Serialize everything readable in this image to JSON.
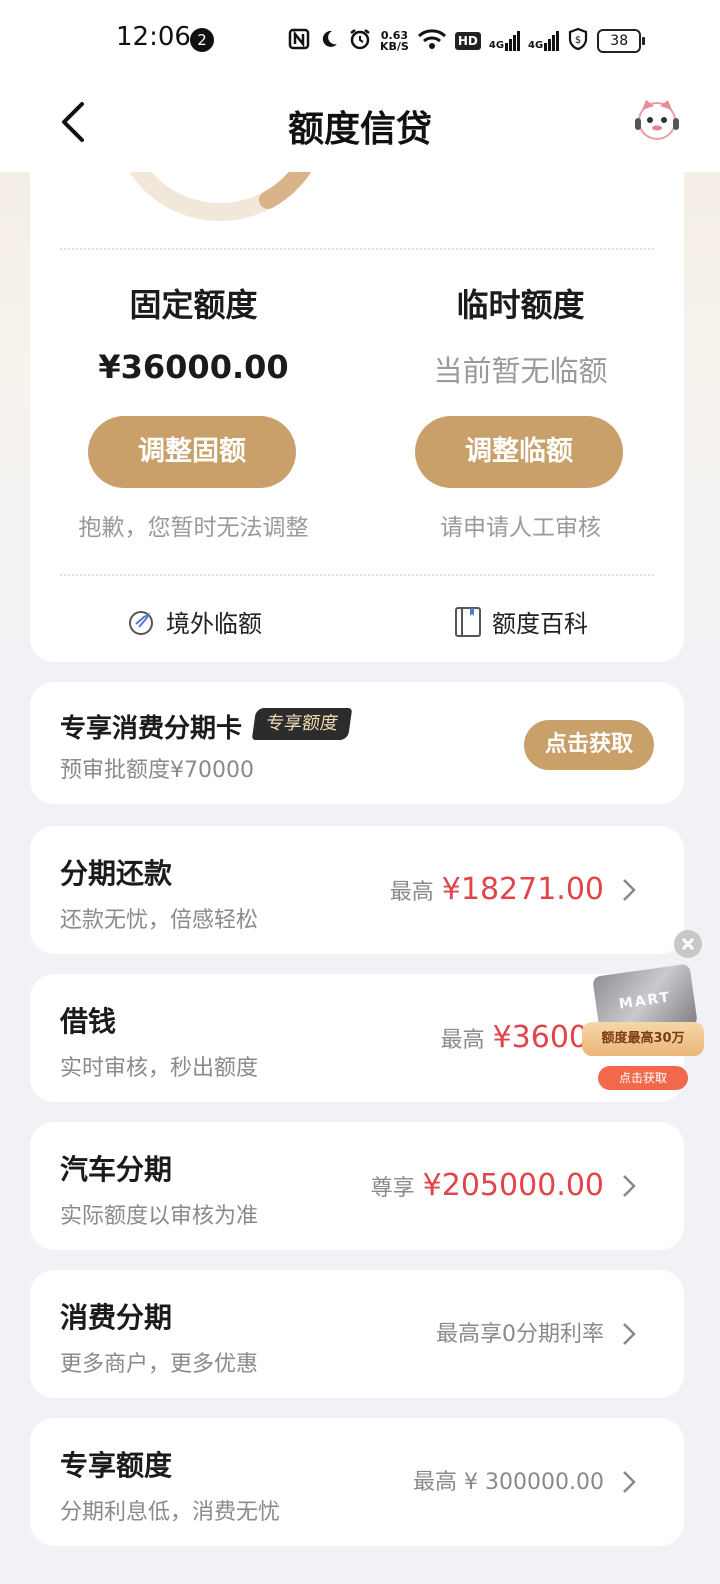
{
  "status_bar": {
    "time": "12:06",
    "notif_count": "2",
    "net_speed_top": "0.63",
    "net_speed_bottom": "KB/S",
    "battery": "38"
  },
  "header": {
    "title": "额度信贷"
  },
  "quota": {
    "fixed": {
      "title": "固定额度",
      "amount": "¥36000.00",
      "button": "调整固额",
      "note": "抱歉，您暂时无法调整"
    },
    "temp": {
      "title": "临时额度",
      "amount": "当前暂无临额",
      "button": "调整临额",
      "note": "请申请人工审核"
    },
    "links": {
      "overseas": "境外临额",
      "wiki": "额度百科"
    }
  },
  "exclusive_card": {
    "title": "专享消费分期卡",
    "badge": "专享额度",
    "subtitle": "预审批额度¥70000",
    "button": "点击获取"
  },
  "products": [
    {
      "title": "分期还款",
      "subtitle": "还款无忧，倍感轻松",
      "prefix": "最高",
      "amount": "¥18271.00"
    },
    {
      "title": "借钱",
      "subtitle": "实时审核，秒出额度",
      "prefix": "最高",
      "amount": "¥3600"
    },
    {
      "title": "汽车分期",
      "subtitle": "实际额度以审核为准",
      "prefix": "尊享",
      "amount": "¥205000.00"
    },
    {
      "title": "消费分期",
      "subtitle": "更多商户，更多优惠",
      "prefix": "最高享0分期利率",
      "amount": ""
    },
    {
      "title": "专享额度",
      "subtitle": "分期利息低，消费无忧",
      "prefix": "最高 ¥ 300000.00",
      "amount": ""
    }
  ],
  "float_ad": {
    "card_text": "MART",
    "ribbon": "额度最高30万",
    "button": "点击获取"
  },
  "colors": {
    "gold": "#c9a06a",
    "red": "#e0454b",
    "page_bg": "#f1f2f6"
  }
}
